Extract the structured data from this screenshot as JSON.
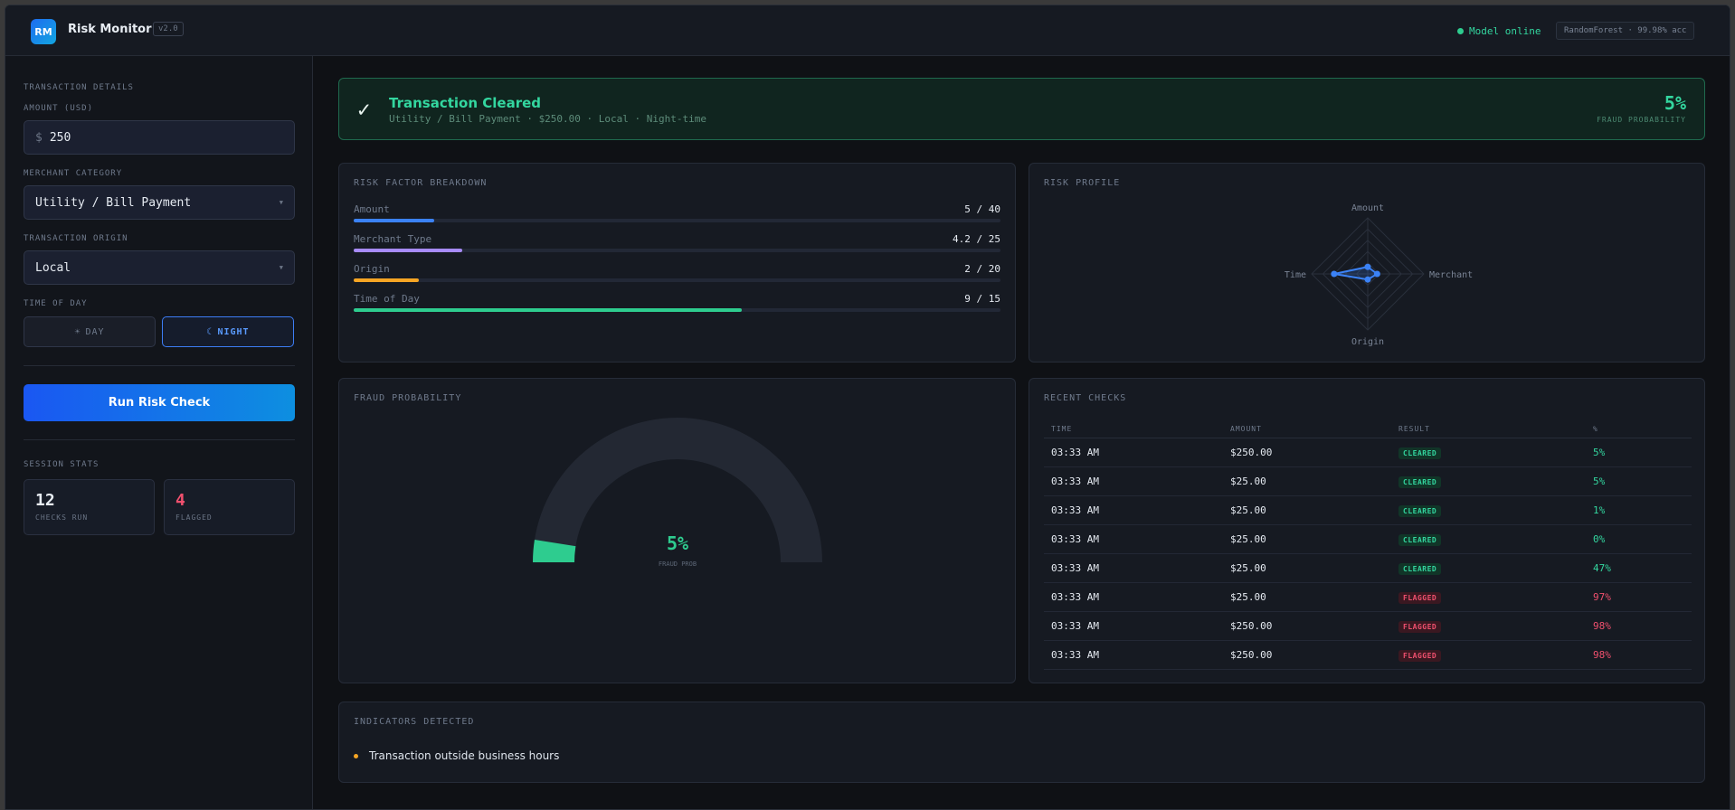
{
  "app": {
    "logo": "RM",
    "title": "Risk Monitor",
    "version": "v2.0",
    "status": "Model online",
    "model": "RandomForest · 99.98% acc"
  },
  "sidebar": {
    "section_title": "TRANSACTION DETAILS",
    "amount_label": "AMOUNT (USD)",
    "amount_prefix": "$",
    "amount_value": "250",
    "category_label": "MERCHANT CATEGORY",
    "category_value": "Utility / Bill Payment",
    "origin_label": "TRANSACTION ORIGIN",
    "origin_value": "Local",
    "time_label": "TIME OF DAY",
    "day_icon": "☀",
    "day_label": "DAY",
    "night_icon": "☾",
    "night_label": "NIGHT",
    "time_selected": "night",
    "run_button": "Run Risk Check",
    "stats_title": "SESSION STATS",
    "checks_run": "12",
    "checks_run_label": "CHECKS RUN",
    "flagged": "4",
    "flagged_label": "FLAGGED"
  },
  "banner": {
    "title": "Transaction Cleared",
    "subtitle": "Utility / Bill Payment · $250.00 · Local · Night-time",
    "percent": "5%",
    "percent_label": "FRAUD PROBABILITY"
  },
  "factors": {
    "title": "RISK FACTOR BREAKDOWN",
    "items": [
      {
        "name": "Amount",
        "value": "5 / 40",
        "fraction": 0.125,
        "color": "#3b82f6"
      },
      {
        "name": "Merchant Type",
        "value": "4.2 / 25",
        "fraction": 0.168,
        "color": "#a78bfa"
      },
      {
        "name": "Origin",
        "value": "2 / 20",
        "fraction": 0.1,
        "color": "#f5a524"
      },
      {
        "name": "Time of Day",
        "value": "9 / 15",
        "fraction": 0.6,
        "color": "#2ecc8f"
      }
    ]
  },
  "profile": {
    "title": "RISK PROFILE",
    "axes": [
      "Amount",
      "Merchant",
      "Origin",
      "Time"
    ],
    "values": [
      0.125,
      0.168,
      0.1,
      0.6
    ],
    "color": "#3b82f6"
  },
  "gauge": {
    "title": "FRAUD PROBABILITY",
    "value": 0.05,
    "value_text": "5%",
    "label": "FRAUD PROB",
    "color": "#2ecc8f"
  },
  "recent": {
    "title": "RECENT CHECKS",
    "columns": [
      "TIME",
      "AMOUNT",
      "RESULT",
      "%"
    ],
    "rows": [
      {
        "time": "03:33 AM",
        "amount": "$250.00",
        "result": "CLEARED",
        "pct": "5%"
      },
      {
        "time": "03:33 AM",
        "amount": "$25.00",
        "result": "CLEARED",
        "pct": "5%"
      },
      {
        "time": "03:33 AM",
        "amount": "$25.00",
        "result": "CLEARED",
        "pct": "1%"
      },
      {
        "time": "03:33 AM",
        "amount": "$25.00",
        "result": "CLEARED",
        "pct": "0%"
      },
      {
        "time": "03:33 AM",
        "amount": "$25.00",
        "result": "CLEARED",
        "pct": "47%"
      },
      {
        "time": "03:33 AM",
        "amount": "$25.00",
        "result": "FLAGGED",
        "pct": "97%"
      },
      {
        "time": "03:33 AM",
        "amount": "$250.00",
        "result": "FLAGGED",
        "pct": "98%"
      },
      {
        "time": "03:33 AM",
        "amount": "$250.00",
        "result": "FLAGGED",
        "pct": "98%"
      }
    ]
  },
  "indicators": {
    "title": "INDICATORS DETECTED",
    "items": [
      "Transaction outside business hours"
    ]
  }
}
